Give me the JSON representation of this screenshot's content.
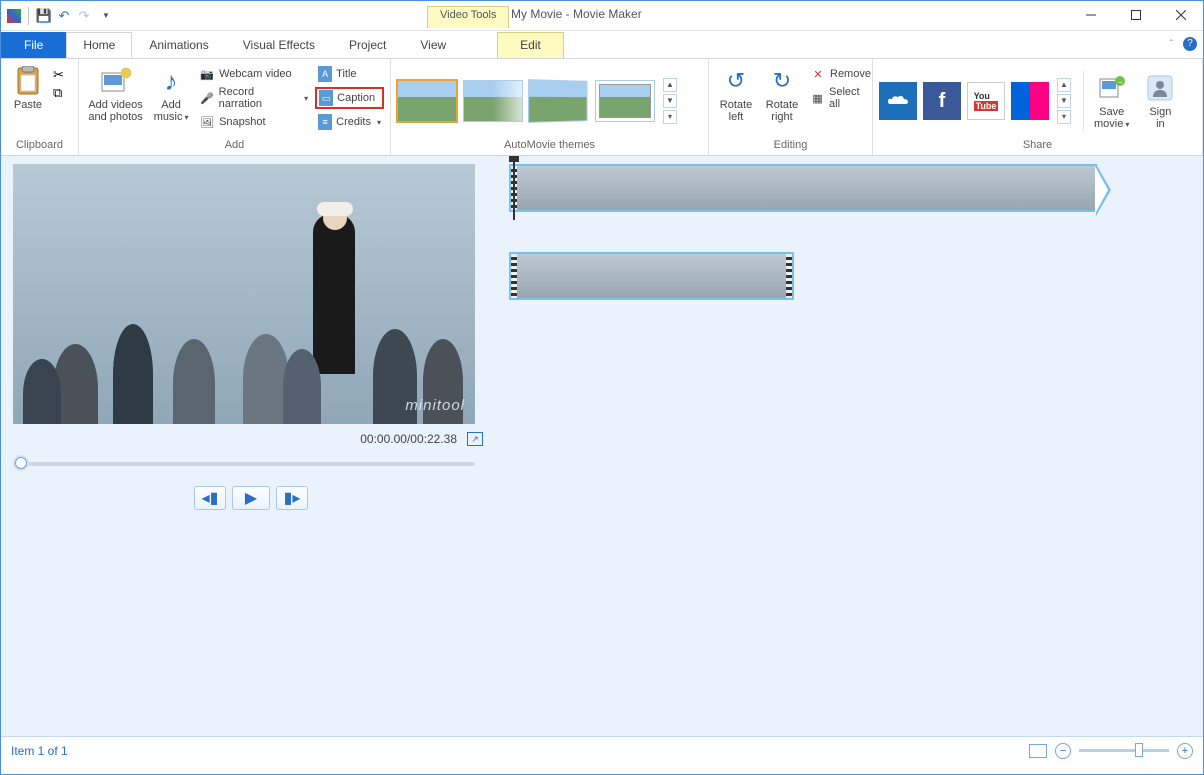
{
  "titlebar": {
    "context_tab": "Video Tools",
    "app_title": "My Movie - Movie Maker"
  },
  "tabs": {
    "file": "File",
    "home": "Home",
    "animations": "Animations",
    "visual_effects": "Visual Effects",
    "project": "Project",
    "view": "View",
    "edit": "Edit"
  },
  "ribbon": {
    "clipboard": {
      "label": "Clipboard",
      "paste": "Paste"
    },
    "add": {
      "label": "Add",
      "add_videos": "Add videos\nand photos",
      "add_music": "Add\nmusic",
      "webcam": "Webcam video",
      "record": "Record narration",
      "snapshot": "Snapshot",
      "title": "Title",
      "caption": "Caption",
      "credits": "Credits"
    },
    "automovie": {
      "label": "AutoMovie themes"
    },
    "editing": {
      "label": "Editing",
      "rotate_left": "Rotate\nleft",
      "rotate_right": "Rotate\nright",
      "remove": "Remove",
      "select_all": "Select all"
    },
    "share": {
      "label": "Share",
      "save_movie": "Save\nmovie",
      "sign_in": "Sign\nin"
    }
  },
  "preview": {
    "time": "00:00.00/00:22.38",
    "watermark": "minitool"
  },
  "status": {
    "item_count": "Item 1 of 1"
  },
  "colors": {
    "accent": "#1a6fd6",
    "highlight": "#d93025",
    "context": "#fffac2"
  }
}
